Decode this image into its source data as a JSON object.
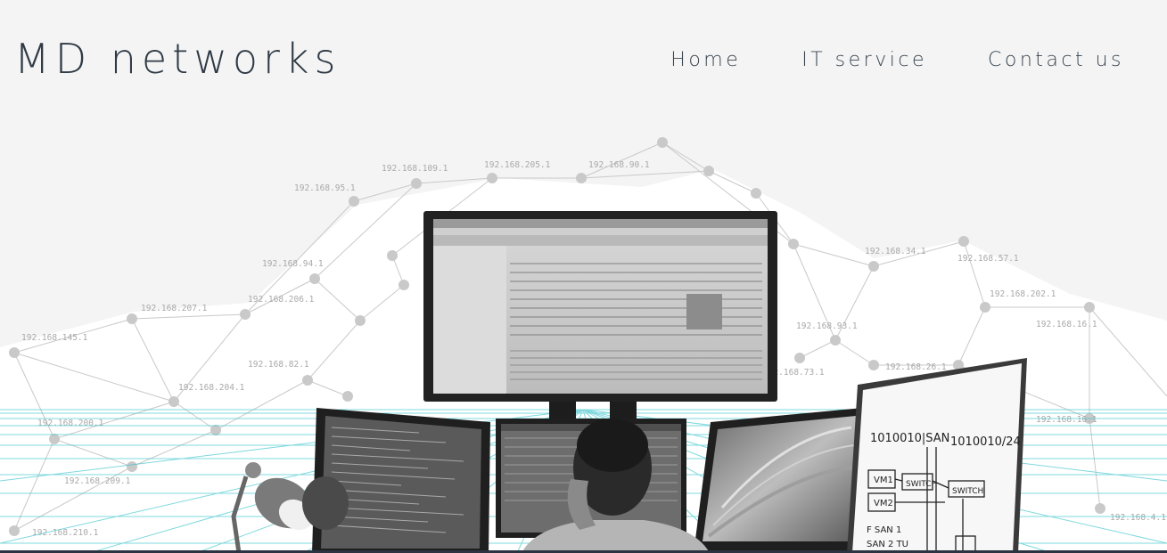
{
  "header": {
    "brand": "MD networks"
  },
  "nav": {
    "items": [
      {
        "label": "Home"
      },
      {
        "label": "IT service"
      },
      {
        "label": "Contact us"
      }
    ]
  },
  "hero": {
    "ip_labels": [
      "192.168.109.1",
      "192.168.205.1",
      "192.168.90.1",
      "192.168.95.1",
      "192.168.94.1",
      "192.168.206.1",
      "192.168.207.1",
      "192.168.145.1",
      "192.168.82.1",
      "192.168.204.1",
      "192.168.200.1",
      "192.168.209.1",
      "192.168.210.1",
      "192.168.34.1",
      "192.168.57.1",
      "192.168.202.1",
      "192.168.93.1",
      "192.168.16.1",
      "192.168.26.1",
      "192.168.73.1",
      "192.168.16.1",
      "192.168.4.1"
    ],
    "whiteboard": {
      "line1": "1010010|SAN",
      "line2": "1010010/24",
      "box1": "VM1",
      "box2": "SWITCH",
      "box3": "SWITCH",
      "box4": "VM2",
      "note1": "F SAN 1",
      "note2": "SAN 2 TU"
    },
    "accent_color": "#3cc4cc"
  }
}
